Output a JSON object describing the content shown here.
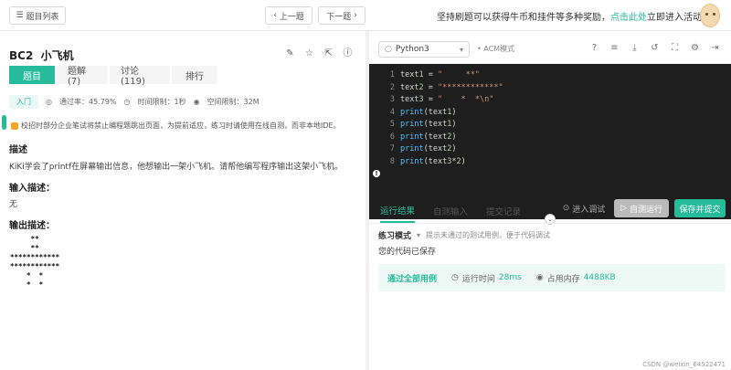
{
  "topbar": {
    "problem_list": "题目列表",
    "prev": "上一题",
    "next": "下一题",
    "promo_text": "坚持刷题可以获得牛币和挂件等多种奖励，",
    "promo_link": "点击此处",
    "promo_tail": "立即进入活动页面"
  },
  "problem": {
    "title": "BC2  小飞机",
    "tabs": [
      "题目",
      "题解(7)",
      "讨论(119)",
      "排行"
    ],
    "level": "入门",
    "pass_rate": "通过率：45.79%",
    "time_limit": "时间限制：1秒",
    "space_limit": "空间限制：32M",
    "warning": "校招时部分企业笔试将禁止编程题跳出页面，为提前适应，练习时请使用在线自测，而非本地IDE。",
    "desc_heading": "描述",
    "desc_text": "KiKi学会了printf在屏幕输出信息，他想输出一架小飞机。请帮他编写程序输出这架小飞机。",
    "input_heading": "输入描述：",
    "input_text": "无",
    "output_heading": "输出描述：",
    "ascii_art": "     **\n     **\n************\n************\n    *  *\n    *  *"
  },
  "editor": {
    "language": "Python3",
    "mode": "ACM模式",
    "lines": [
      {
        "n": "1",
        "code": "text1 = \"     **\""
      },
      {
        "n": "2",
        "code": "text2 = \"************\""
      },
      {
        "n": "3",
        "code": "text3 = \"    *  *\\n\""
      },
      {
        "n": "4",
        "code": "print(text1)"
      },
      {
        "n": "5",
        "code": "print(text1)"
      },
      {
        "n": "6",
        "code": "print(text2)"
      },
      {
        "n": "7",
        "code": "print(text2)"
      },
      {
        "n": "8",
        "code": "print(text3*2)"
      }
    ]
  },
  "results": {
    "tabs": [
      "运行结果",
      "自测输入",
      "提交记录"
    ],
    "btn_enter_debug": "进入调试",
    "btn_self_run": "自测运行",
    "btn_save_submit": "保存并提交",
    "practice_mode": "练习模式",
    "practice_hint": "提示未通过的测试用例，便于代码调试",
    "saved_text": "您的代码已保存",
    "pass_text": "通过全部用例",
    "runtime_label": "运行时间",
    "runtime_value": "28ms",
    "memory_label": "占用内存",
    "memory_value": "4488KB"
  },
  "watermark": "CSDN @weixin_64522471",
  "colors": {
    "accent": "#25bb9b",
    "editor_bg": "#1e1e1e"
  }
}
